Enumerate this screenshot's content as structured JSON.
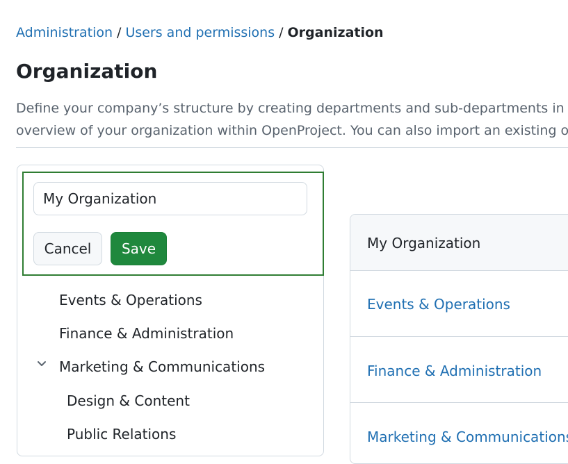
{
  "breadcrumb": {
    "items": [
      "Administration",
      "Users and permissions"
    ],
    "separator": "/",
    "current": "Organization"
  },
  "page": {
    "title": "Organization",
    "description_line1": "Define your company’s structure by creating departments and sub-departments in a h",
    "description_line2": "overview of your organization within OpenProject. You can also import an existing org"
  },
  "edit_form": {
    "name_value": "My Organization",
    "cancel_label": "Cancel",
    "save_label": "Save"
  },
  "tree": {
    "items": [
      {
        "label": "Events & Operations",
        "level": 1
      },
      {
        "label": "Finance & Administration",
        "level": 1
      },
      {
        "label": "Marketing & Communications",
        "level": 1,
        "expanded": true
      },
      {
        "label": "Design & Content",
        "level": 2
      },
      {
        "label": "Public Relations",
        "level": 2
      }
    ]
  },
  "detail": {
    "header": "My Organization",
    "rows": [
      "Events & Operations",
      "Finance & Administration",
      "Marketing & Communications"
    ]
  },
  "colors": {
    "link": "#1f6fb2",
    "focus_border": "#2f7d32",
    "primary_button": "#1f883d"
  }
}
